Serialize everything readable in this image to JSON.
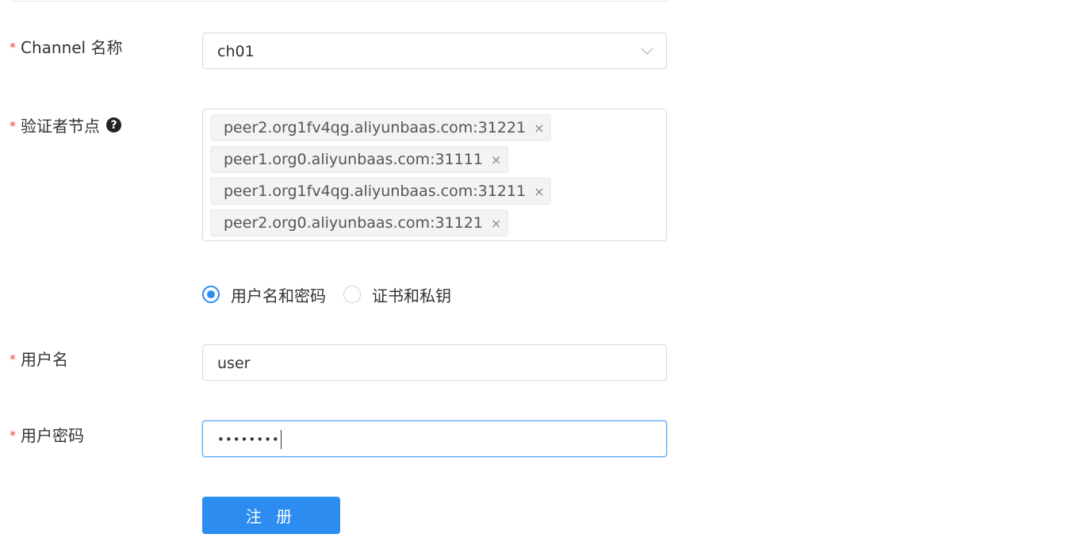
{
  "form": {
    "channel": {
      "required_mark": "*",
      "label": "Channel 名称",
      "value": "ch01",
      "chevron_icon": "chevron-down-icon"
    },
    "endorsers": {
      "required_mark": "*",
      "label": "验证者节点",
      "help_icon_glyph": "?",
      "tags": [
        "peer2.org1fv4qg.aliyunbaas.com:31221",
        "peer1.org0.aliyunbaas.com:31111",
        "peer1.org1fv4qg.aliyunbaas.com:31211",
        "peer2.org0.aliyunbaas.com:31121"
      ],
      "tag_close_glyph": "×"
    },
    "auth_method": {
      "options": [
        "用户名和密码",
        "证书和私钥"
      ],
      "selected_index": 0
    },
    "username": {
      "required_mark": "*",
      "label": "用户名",
      "value": "user"
    },
    "password": {
      "required_mark": "*",
      "label": "用户密码",
      "masked_value": "••••••••"
    },
    "submit_label": "注 册"
  },
  "colors": {
    "primary": "#2d8cf0",
    "required": "#f04134",
    "border": "#d9d9d9",
    "tag_bg": "#f3f3f3"
  }
}
